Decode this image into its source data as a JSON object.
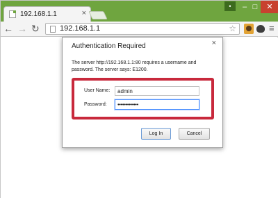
{
  "tab": {
    "title": "192.168.1.1",
    "close_glyph": "×"
  },
  "window_controls": {
    "user": "•",
    "minimize": "–",
    "maximize": "□",
    "close": "✕"
  },
  "toolbar": {
    "back_glyph": "←",
    "forward_glyph": "→",
    "reload_glyph": "↻",
    "url": "192.168.1.1",
    "star_glyph": "☆",
    "menu_glyph": "≡"
  },
  "icons": {
    "tab_favicon": "page-icon",
    "omnibox_page": "page-icon",
    "bookmark": "star-icon",
    "extension_1": "extension-icon",
    "extension_2": "extension-icon",
    "menu": "hamburger-menu-icon"
  },
  "dialog": {
    "title": "Authentication Required",
    "close_glyph": "×",
    "message": "The server http://192.168.1.1:80 requires a username and password. The server says: E1200.",
    "username_label": "User Name:",
    "username_value": "admin",
    "password_label": "Password:",
    "password_value": "•••••••••••••",
    "login_label": "Log In",
    "cancel_label": "Cancel"
  },
  "colors": {
    "window_frame": "#6fa53f",
    "highlight": "#c8293c",
    "focus_ring": "#4d90fe",
    "close_button": "#c8412f"
  }
}
